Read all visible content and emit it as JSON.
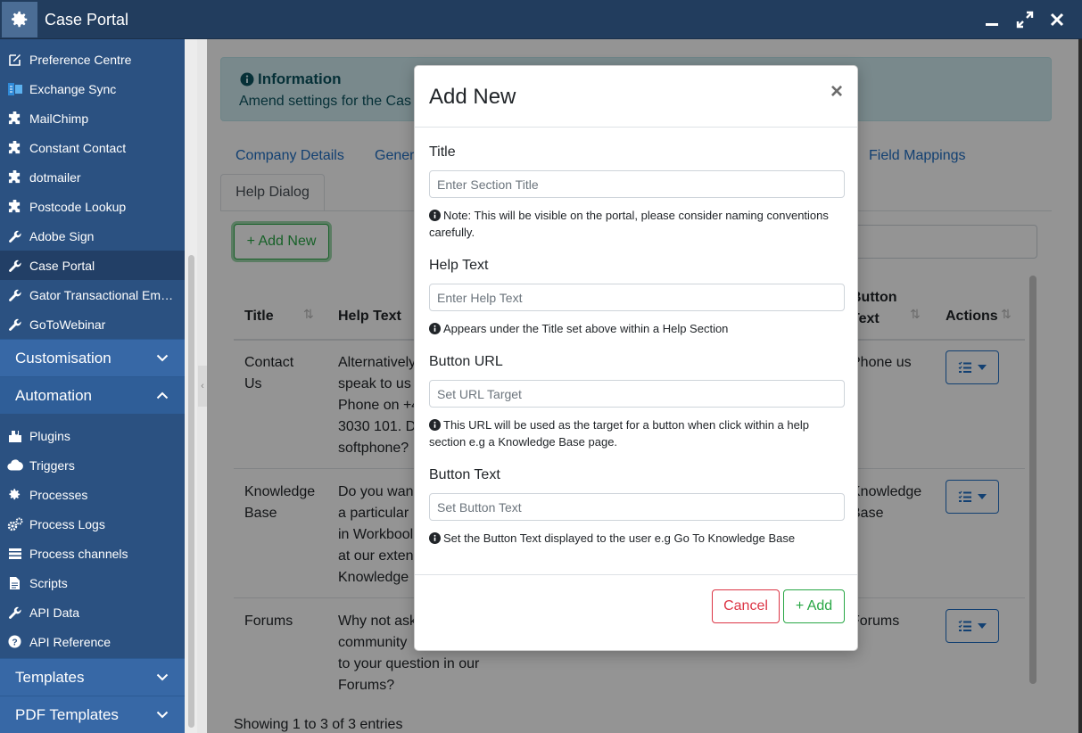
{
  "window": {
    "title": "Case Portal"
  },
  "sidebar": {
    "items": [
      {
        "label": "Preference Centre",
        "icon": "edit-icon"
      },
      {
        "label": "Exchange Sync",
        "icon": "exchange-icon"
      },
      {
        "label": "MailChimp",
        "icon": "puzzle-icon"
      },
      {
        "label": "Constant Contact",
        "icon": "puzzle-icon"
      },
      {
        "label": "dotmailer",
        "icon": "puzzle-icon"
      },
      {
        "label": "Postcode Lookup",
        "icon": "puzzle-icon"
      },
      {
        "label": "Adobe Sign",
        "icon": "wrench-icon"
      },
      {
        "label": "Case Portal",
        "icon": "wrench-icon",
        "active": true
      },
      {
        "label": "Gator Transactional Ema...",
        "icon": "wrench-icon"
      },
      {
        "label": "GoToWebinar",
        "icon": "wrench-icon"
      }
    ],
    "groups": {
      "customisation": "Customisation",
      "automation": "Automation",
      "templates": "Templates",
      "pdf_templates": "PDF Templates"
    },
    "automation_items": [
      {
        "label": "Plugins",
        "icon": "plugins-icon"
      },
      {
        "label": "Triggers",
        "icon": "cloud-icon"
      },
      {
        "label": "Processes",
        "icon": "gear-icon"
      },
      {
        "label": "Process Logs",
        "icon": "gears-icon"
      },
      {
        "label": "Process channels",
        "icon": "stream-icon"
      },
      {
        "label": "Scripts",
        "icon": "file-icon"
      },
      {
        "label": "API Data",
        "icon": "wrench-icon"
      },
      {
        "label": "API Reference",
        "icon": "question-icon"
      }
    ]
  },
  "page": {
    "info": {
      "title": "Information",
      "text": "Amend settings for the Cas"
    },
    "tabs": {
      "company_details": "Company Details",
      "general": "Gener",
      "field_mappings": "Field Mappings",
      "help_dialog": "Help Dialog"
    },
    "add_new_button": "+ Add New",
    "table": {
      "headers": {
        "title": "Title",
        "help_text": "Help Text",
        "button_text": "Button\nText",
        "actions": "Actions"
      },
      "rows": [
        {
          "title": "Contact\nUs",
          "help_text": "Alternatively\nspeak to us\nPhone on +4\n3030 101. D\nsoftphone?",
          "button_text": "Phone us"
        },
        {
          "title": "Knowledge\nBase",
          "help_text": "Do you wan\na particular\nin Workbool\nat our exten\nKnowledge",
          "button_text": "Knowledge\nBase"
        },
        {
          "title": "Forums",
          "help_text": "Why not ask\ncommunity\nto your question in our\nForums?",
          "button_text": "Forums"
        }
      ]
    },
    "footer": "Showing 1 to 3 of 3 entries"
  },
  "modal": {
    "title": "Add New",
    "fields": {
      "title": {
        "label": "Title",
        "placeholder": "Enter Section Title",
        "value": "",
        "note": "Note: This will be visible on the portal, please consider naming conventions carefully."
      },
      "help_text": {
        "label": "Help Text",
        "placeholder": "Enter Help Text",
        "value": "",
        "note": "Appears under the Title set above within a Help Section"
      },
      "button_url": {
        "label": "Button URL",
        "placeholder": "Set URL Target",
        "value": "",
        "note": "This URL will be used as the target for a button when click within a help section e.g a Knowledge Base page."
      },
      "button_text": {
        "label": "Button Text",
        "placeholder": "Set Button Text",
        "value": "",
        "note": "Set the Button Text displayed to the user e.g Go To Knowledge Base"
      }
    },
    "cancel_label": "Cancel",
    "add_label": "+ Add"
  },
  "colors": {
    "titlebar": "#223d5e",
    "sidebar": "#2b5181",
    "sidebar_group": "#3768a6",
    "link_blue": "#1f6fc4",
    "success": "#28a745",
    "danger": "#dc3545",
    "info_bg": "#d1ecf1"
  }
}
